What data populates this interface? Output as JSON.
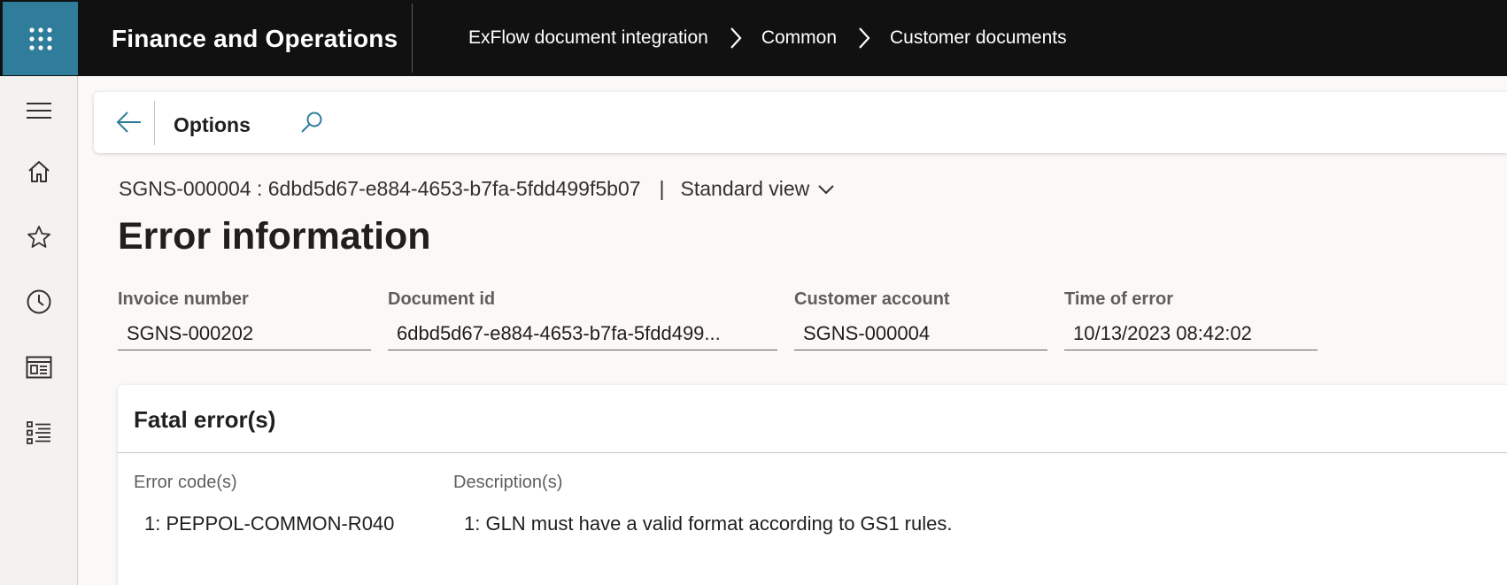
{
  "app": {
    "title": "Finance and Operations"
  },
  "breadcrumb": [
    "ExFlow document integration",
    "Common",
    "Customer documents"
  ],
  "nav": {
    "items": [
      "menu-icon",
      "home-icon",
      "star-icon",
      "clock-icon",
      "workspace-icon",
      "list-icon"
    ]
  },
  "actionpane": {
    "options_label": "Options"
  },
  "caption": {
    "record": "SGNS-000004 : 6dbd5d67-e884-4653-b7fa-5fdd499f5b07",
    "separator": "|",
    "view": "Standard view"
  },
  "page_title": "Error information",
  "fields": {
    "invoice_number": {
      "label": "Invoice number",
      "value": "SGNS-000202"
    },
    "document_id": {
      "label": "Document id",
      "value": "6dbd5d67-e884-4653-b7fa-5fdd499..."
    },
    "customer_account": {
      "label": "Customer account",
      "value": "SGNS-000004"
    },
    "time_of_error": {
      "label": "Time of error",
      "value": "10/13/2023 08:42:02"
    }
  },
  "fatal_errors": {
    "title": "Fatal error(s)",
    "columns": [
      "Error code(s)",
      "Description(s)"
    ],
    "rows": [
      {
        "code": "1: PEPPOL-COMMON-R040",
        "description": "1: GLN must have a valid format according to GS1 rules."
      }
    ]
  },
  "colors": {
    "topbar": "#111111",
    "waffle": "#2f7d9a",
    "accent": "#2f7d9a",
    "page_bg": "#faf9f8"
  }
}
